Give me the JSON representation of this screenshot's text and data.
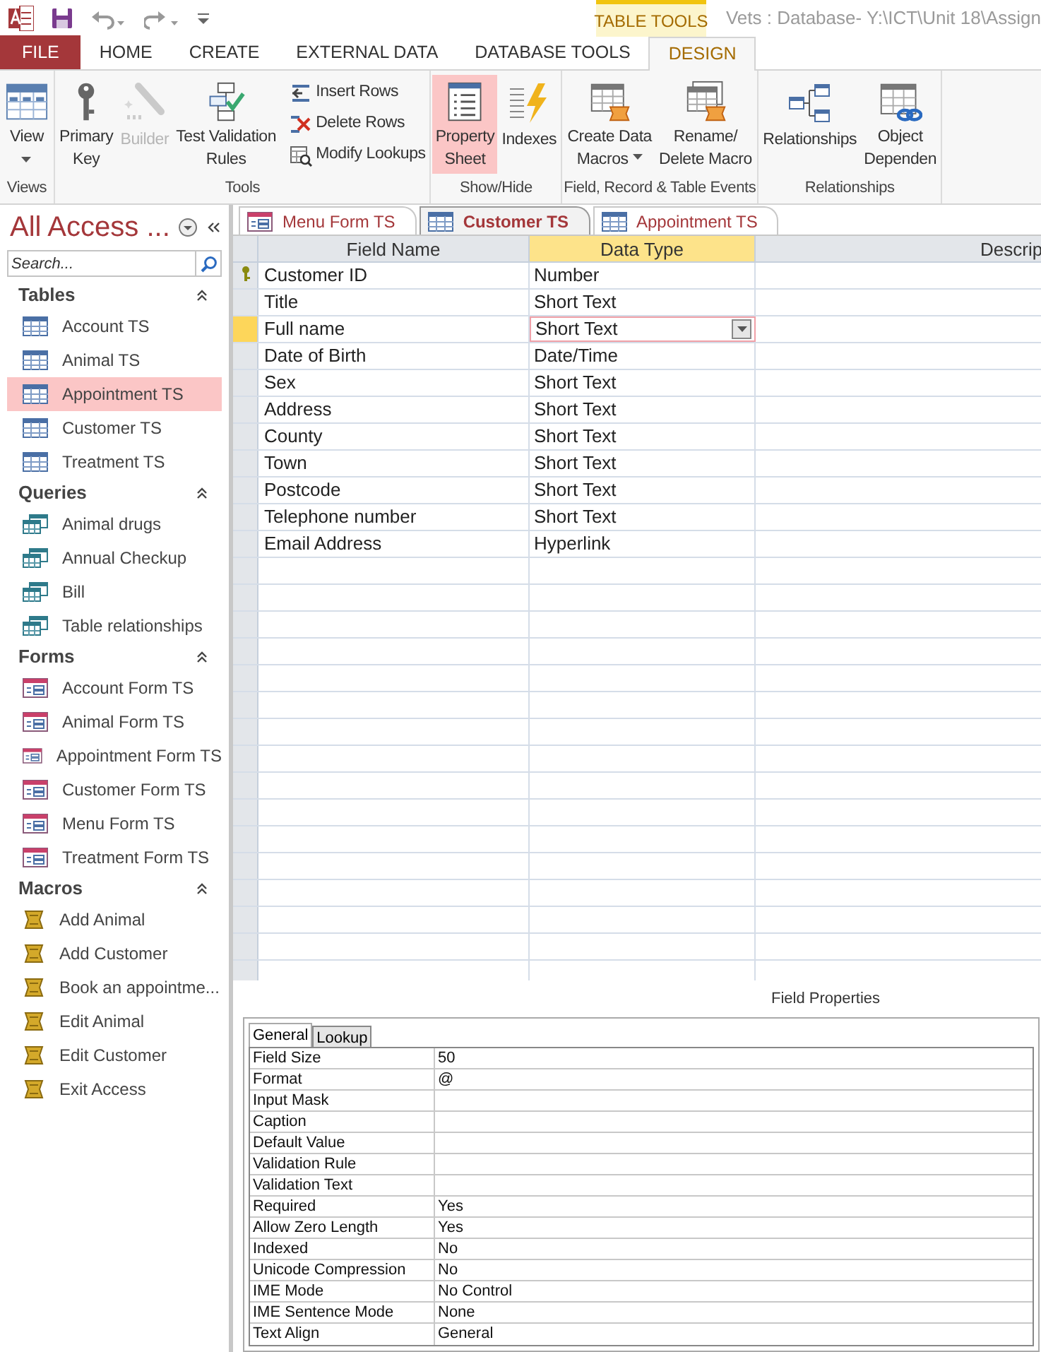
{
  "title_bar": {
    "context_label": "TABLE TOOLS",
    "title": "Vets : Database- Y:\\ICT\\Unit 18\\Assign"
  },
  "ribbon_tabs": [
    {
      "label": "FILE",
      "kind": "file",
      "selected": false
    },
    {
      "label": "HOME",
      "kind": "plain",
      "selected": false
    },
    {
      "label": "CREATE",
      "kind": "plain",
      "selected": false
    },
    {
      "label": "EXTERNAL DATA",
      "kind": "plain",
      "selected": false
    },
    {
      "label": "DATABASE TOOLS",
      "kind": "plain",
      "selected": false
    },
    {
      "label": "DESIGN",
      "kind": "context",
      "selected": true
    }
  ],
  "ribbon_groups": [
    {
      "label": "Views",
      "buttons": [
        {
          "kind": "large",
          "lines": [
            "View"
          ],
          "dropdown": true,
          "disabled": false,
          "selected": false
        }
      ]
    },
    {
      "label": "Tools",
      "buttons": [
        {
          "kind": "large",
          "lines": [
            "Primary",
            "Key"
          ],
          "dropdown": false,
          "disabled": false,
          "selected": false
        },
        {
          "kind": "large",
          "lines": [
            "Builder"
          ],
          "dropdown": false,
          "disabled": true,
          "selected": false
        },
        {
          "kind": "large",
          "lines": [
            "Test Validation",
            "Rules"
          ],
          "dropdown": false,
          "disabled": false,
          "selected": false
        },
        {
          "kind": "small",
          "lines": [
            "Insert Rows"
          ],
          "disabled": false,
          "selected": false
        },
        {
          "kind": "small",
          "lines": [
            "Delete Rows"
          ],
          "disabled": false,
          "selected": false
        },
        {
          "kind": "small",
          "lines": [
            "Modify Lookups"
          ],
          "disabled": false,
          "selected": false
        }
      ]
    },
    {
      "label": "Show/Hide",
      "buttons": [
        {
          "kind": "large",
          "lines": [
            "Property",
            "Sheet"
          ],
          "dropdown": false,
          "disabled": false,
          "selected": true
        },
        {
          "kind": "large",
          "lines": [
            "Indexes"
          ],
          "dropdown": false,
          "disabled": false,
          "selected": false
        }
      ]
    },
    {
      "label": "Field, Record & Table Events",
      "buttons": [
        {
          "kind": "large",
          "lines": [
            "Create Data",
            "Macros"
          ],
          "dropdown": true,
          "disabled": false,
          "selected": false
        },
        {
          "kind": "large",
          "lines": [
            "Rename/",
            "Delete Macro"
          ],
          "dropdown": false,
          "disabled": false,
          "selected": false
        }
      ]
    },
    {
      "label": "Relationships",
      "buttons": [
        {
          "kind": "large",
          "lines": [
            "Relationships"
          ],
          "dropdown": false,
          "disabled": false,
          "selected": false
        },
        {
          "kind": "large",
          "lines": [
            "Object",
            "Dependen"
          ],
          "dropdown": false,
          "disabled": false,
          "selected": false
        }
      ]
    }
  ],
  "nav_pane": {
    "title": "All Access ...",
    "search": {
      "placeholder": "Search..."
    },
    "groups": [
      {
        "label": "Tables",
        "kind": "table",
        "items": [
          {
            "label": "Account TS",
            "selected": false
          },
          {
            "label": "Animal TS",
            "selected": false
          },
          {
            "label": "Appointment TS",
            "selected": true
          },
          {
            "label": "Customer TS",
            "selected": false
          },
          {
            "label": "Treatment TS",
            "selected": false
          }
        ]
      },
      {
        "label": "Queries",
        "kind": "query",
        "items": [
          {
            "label": "Animal drugs",
            "selected": false
          },
          {
            "label": "Annual Checkup",
            "selected": false
          },
          {
            "label": "Bill",
            "selected": false
          },
          {
            "label": "Table relationships",
            "selected": false
          }
        ]
      },
      {
        "label": "Forms",
        "kind": "form",
        "items": [
          {
            "label": "Account Form TS",
            "selected": false
          },
          {
            "label": "Animal Form TS",
            "selected": false
          },
          {
            "label": "Appointment Form TS",
            "selected": false
          },
          {
            "label": "Customer Form TS",
            "selected": false
          },
          {
            "label": "Menu Form TS",
            "selected": false
          },
          {
            "label": "Treatment Form TS",
            "selected": false
          }
        ]
      },
      {
        "label": "Macros",
        "kind": "macro",
        "items": [
          {
            "label": "Add Animal",
            "selected": false
          },
          {
            "label": "Add Customer",
            "selected": false
          },
          {
            "label": "Book an appointme...",
            "selected": false
          },
          {
            "label": "Edit Animal",
            "selected": false
          },
          {
            "label": "Edit Customer",
            "selected": false
          },
          {
            "label": "Exit Access",
            "selected": false
          }
        ]
      }
    ]
  },
  "document_tabs": [
    {
      "label": "Menu Form TS",
      "kind": "form",
      "selected": false
    },
    {
      "label": "Customer TS",
      "kind": "table",
      "selected": true
    },
    {
      "label": "Appointment TS",
      "kind": "table",
      "selected": false
    }
  ],
  "design_grid": {
    "columns": [
      {
        "label": "Field Name",
        "selected": false
      },
      {
        "label": "Data Type",
        "selected": true
      },
      {
        "label": "Descrip",
        "selected": false
      }
    ],
    "rows": [
      {
        "field": "Customer ID",
        "type": "Number",
        "primary_key": true,
        "selected": false
      },
      {
        "field": "Title",
        "type": "Short Text",
        "primary_key": false,
        "selected": false
      },
      {
        "field": "Full name",
        "type": "Short Text",
        "primary_key": false,
        "selected": true
      },
      {
        "field": "Date of Birth",
        "type": "Date/Time",
        "primary_key": false,
        "selected": false
      },
      {
        "field": "Sex",
        "type": "Short Text",
        "primary_key": false,
        "selected": false
      },
      {
        "field": "Address",
        "type": "Short Text",
        "primary_key": false,
        "selected": false
      },
      {
        "field": "County",
        "type": "Short Text",
        "primary_key": false,
        "selected": false
      },
      {
        "field": "Town",
        "type": "Short Text",
        "primary_key": false,
        "selected": false
      },
      {
        "field": "Postcode",
        "type": "Short Text",
        "primary_key": false,
        "selected": false
      },
      {
        "field": "Telephone number",
        "type": "Short Text",
        "primary_key": false,
        "selected": false
      },
      {
        "field": "Email Address",
        "type": "Hyperlink",
        "primary_key": false,
        "selected": false
      }
    ]
  },
  "field_properties": {
    "label": "Field Properties",
    "tabs": [
      {
        "label": "General",
        "selected": true
      },
      {
        "label": "Lookup",
        "selected": false
      }
    ],
    "rows": [
      {
        "name": "Field Size",
        "value": "50"
      },
      {
        "name": "Format",
        "value": "@"
      },
      {
        "name": "Input Mask"
      },
      {
        "name": "Caption"
      },
      {
        "name": "Default Value"
      },
      {
        "name": "Validation Rule"
      },
      {
        "name": "Validation Text"
      },
      {
        "name": "Required",
        "value": "Yes"
      },
      {
        "name": "Allow Zero Length",
        "value": "Yes"
      },
      {
        "name": "Indexed",
        "value": "No"
      },
      {
        "name": "Unicode Compression",
        "value": "No"
      },
      {
        "name": "IME Mode",
        "value": "No Control"
      },
      {
        "name": "IME Sentence Mode",
        "value": "None"
      },
      {
        "name": "Text Align",
        "value": "General"
      }
    ]
  }
}
